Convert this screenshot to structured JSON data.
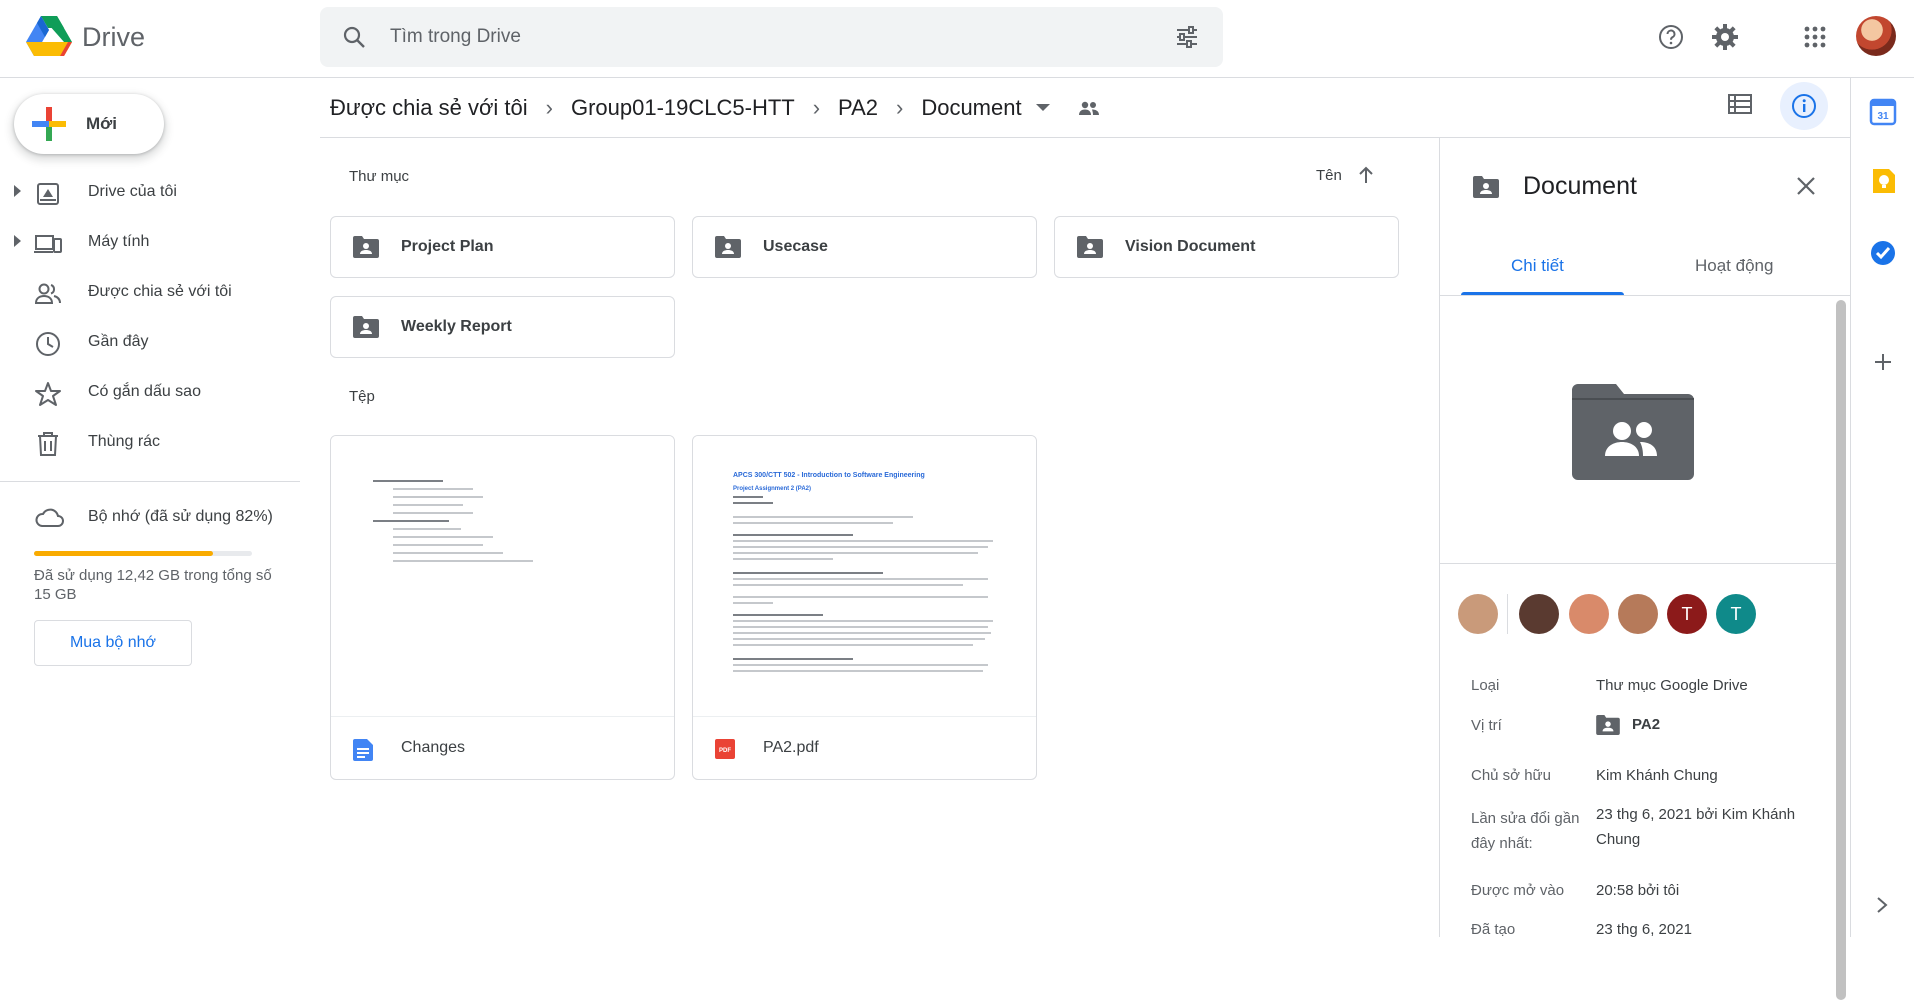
{
  "app": {
    "name": "Drive"
  },
  "search": {
    "placeholder": "Tìm trong Drive"
  },
  "sidebar": {
    "new_label": "Mới",
    "items": [
      {
        "label": "Drive của tôi",
        "expandable": true,
        "icon": "my-drive-icon"
      },
      {
        "label": "Máy tính",
        "expandable": true,
        "icon": "computer-icon"
      },
      {
        "label": "Được chia sẻ với tôi",
        "expandable": false,
        "icon": "shared-icon"
      },
      {
        "label": "Gần đây",
        "expandable": false,
        "icon": "clock-icon"
      },
      {
        "label": "Có gắn dấu sao",
        "expandable": false,
        "icon": "star-icon"
      },
      {
        "label": "Thùng rác",
        "expandable": false,
        "icon": "trash-icon"
      }
    ],
    "storage": {
      "label": "Bộ nhớ (đã sử dụng 82%)",
      "used_fraction": 0.82,
      "detail": "Đã sử dụng 12,42 GB trong tổng số 15 GB",
      "buy_label": "Mua bộ nhớ",
      "bar_color": "#f9ab00"
    }
  },
  "breadcrumb": [
    "Được chia sẻ với tôi",
    "Group01-19CLC5-HTT",
    "PA2",
    "Document"
  ],
  "main": {
    "folders_label": "Thư mục",
    "sort_label": "Tên",
    "folders": [
      "Project Plan",
      "Usecase",
      "Vision Document",
      "Weekly Report"
    ],
    "files_label": "Tệp",
    "files": [
      {
        "name": "Changes",
        "type": "doc"
      },
      {
        "name": "PA2.pdf",
        "type": "pdf"
      }
    ],
    "pdf_preview": {
      "title": "APCS 300/CTT 502 - Introduction to Software Engineering",
      "subtitle": "Project Assignment 2 (PA2)"
    }
  },
  "details": {
    "title": "Document",
    "tabs": [
      "Chi tiết",
      "Hoạt động"
    ],
    "people": [
      {
        "initial": "",
        "color": "#c99a7a"
      },
      {
        "initial": "",
        "color": "#5a3a30"
      },
      {
        "initial": "",
        "color": "#d98a6a"
      },
      {
        "initial": "",
        "color": "#b67a5a"
      },
      {
        "initial": "T",
        "color": "#8c1a1a"
      },
      {
        "initial": "T",
        "color": "#0f8a8a"
      }
    ],
    "rows": [
      {
        "label": "Loại",
        "value": "Thư mục Google Drive"
      },
      {
        "label": "Vị trí",
        "value": "PA2"
      },
      {
        "label": "Chủ sở hữu",
        "value": "Kim Khánh Chung"
      },
      {
        "label": "Lần sửa đổi gần đây nhất:",
        "value": "23 thg 6, 2021 bởi Kim Khánh Chung"
      },
      {
        "label": "Được mở vào",
        "value": "20:58 bởi tôi"
      },
      {
        "label": "Đã tạo",
        "value": "23 thg 6, 2021"
      }
    ]
  },
  "colors": {
    "accent": "#1a73e8",
    "info_active_bg": "#e8f0fe"
  }
}
